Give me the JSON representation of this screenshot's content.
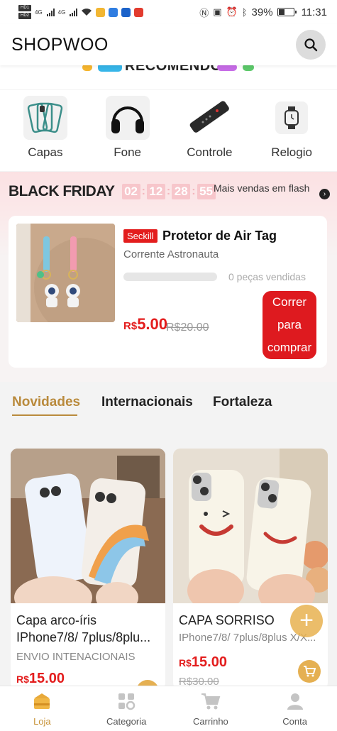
{
  "status_bar": {
    "battery": "39%",
    "time": "11:31",
    "network": "4G"
  },
  "header": {
    "logo": "SHOPWOO"
  },
  "banner": {
    "text": "RECOMENDO"
  },
  "categories": [
    {
      "label": "Capas",
      "icon": "phone-case-icon"
    },
    {
      "label": "Fone",
      "icon": "headphones-icon"
    },
    {
      "label": "Controle",
      "icon": "remote-control-icon"
    },
    {
      "label": "Relogio",
      "icon": "watch-icon"
    }
  ],
  "flash_sale": {
    "title": "BLACK FRIDAY",
    "timer": {
      "d": "02",
      "h": "12",
      "m": "28",
      "s": "55"
    },
    "subtitle": "Mais vendas em flash",
    "product": {
      "badge": "Seckill",
      "title": "Protetor de Air Tag",
      "subtitle": "Corrente Astronauta",
      "sold": "0 peças vendidas",
      "sold_fraction": 0,
      "currency": "R$",
      "price": "5.00",
      "old_price": "R$20.00",
      "buy_label": "Correr para comprar"
    }
  },
  "tabs": [
    {
      "label": "Novidades",
      "active": true
    },
    {
      "label": "Internacionais",
      "active": false
    },
    {
      "label": "Fortaleza",
      "active": false
    }
  ],
  "products": [
    {
      "title": "Capa arco-íris IPhone7/8/ 7plus/8plu...",
      "subtitle": "ENVIO INTENACIONAIS",
      "currency": "R$",
      "price": "15.00",
      "old_price": ""
    },
    {
      "title": "CAPA SORRISO",
      "subtitle": "IPhone7/8/ 7plus/8plus X/X...",
      "currency": "R$",
      "price": "15.00",
      "old_price": "R$30.00"
    }
  ],
  "bottom_nav": [
    {
      "label": "Loja",
      "active": true,
      "icon": "store-icon"
    },
    {
      "label": "Categoria",
      "active": false,
      "icon": "category-icon"
    },
    {
      "label": "Carrinho",
      "active": false,
      "icon": "cart-icon"
    },
    {
      "label": "Conta",
      "active": false,
      "icon": "account-icon"
    }
  ],
  "colors": {
    "accent_gold": "#b98a3c",
    "sale_red": "#e31d1d",
    "flash_bg": "#fbe1e3"
  }
}
